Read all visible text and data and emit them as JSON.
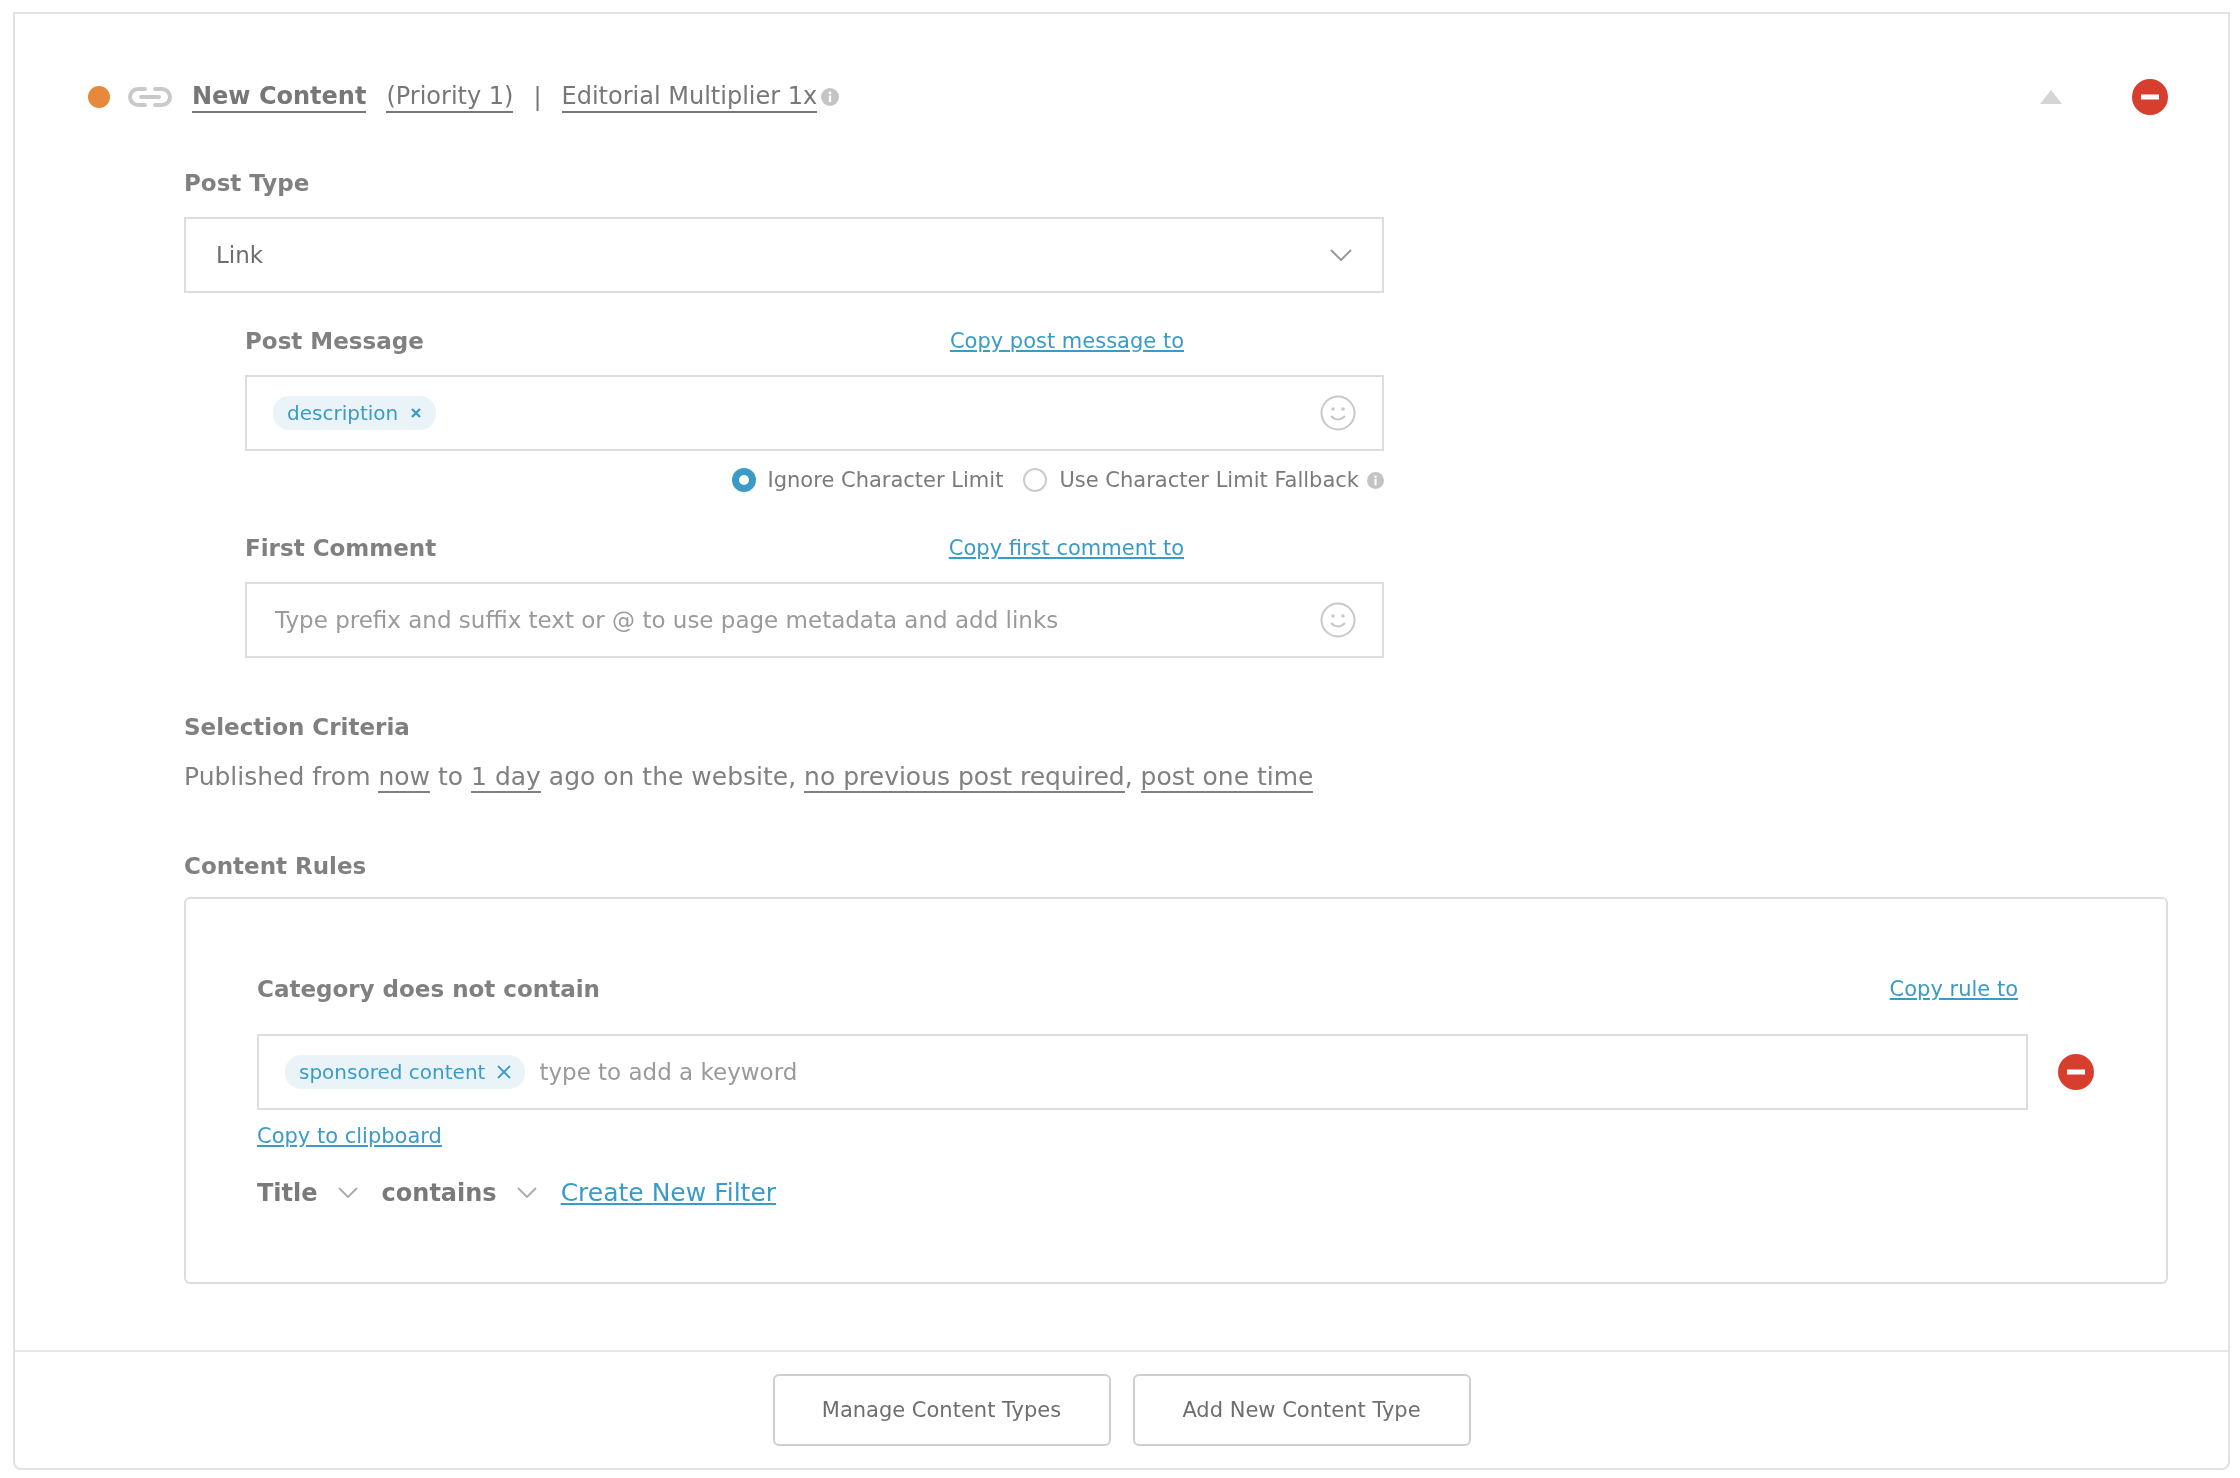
{
  "header": {
    "title": "New Content",
    "priority": "(Priority 1)",
    "separator": "|",
    "multiplier": "Editorial Multiplier 1x"
  },
  "post_type": {
    "label": "Post Type",
    "value": "Link"
  },
  "post_message": {
    "label": "Post Message",
    "copy_link": "Copy post message to",
    "tags": [
      "description"
    ],
    "options": [
      {
        "label": "Ignore Character Limit",
        "selected": true
      },
      {
        "label": "Use Character Limit Fallback",
        "selected": false
      }
    ]
  },
  "first_comment": {
    "label": "First Comment",
    "copy_link": "Copy first comment to",
    "placeholder": "Type prefix and suffix text or @ to use page metadata and add links"
  },
  "selection_criteria": {
    "label": "Selection Criteria",
    "parts": [
      {
        "kind": "text",
        "text": "Published from "
      },
      {
        "kind": "link",
        "text": "now"
      },
      {
        "kind": "text",
        "text": " to "
      },
      {
        "kind": "link",
        "text": "1 day"
      },
      {
        "kind": "text",
        "text": " ago on the website, "
      },
      {
        "kind": "link",
        "text": "no previous post required"
      },
      {
        "kind": "text",
        "text": ", "
      },
      {
        "kind": "link",
        "text": "post one time"
      }
    ]
  },
  "content_rules": {
    "label": "Content Rules",
    "rules": [
      {
        "label": "Category does not contain",
        "copy_link": "Copy rule to",
        "tags": [
          "sponsored content"
        ],
        "placeholder": "type to add a keyword",
        "clipboard_link": "Copy to clipboard"
      }
    ],
    "filter": {
      "field": "Title",
      "operator": "contains",
      "create_link": "Create New Filter"
    }
  },
  "buttons": [
    "Manage Content Types",
    "Add New Content Type"
  ]
}
